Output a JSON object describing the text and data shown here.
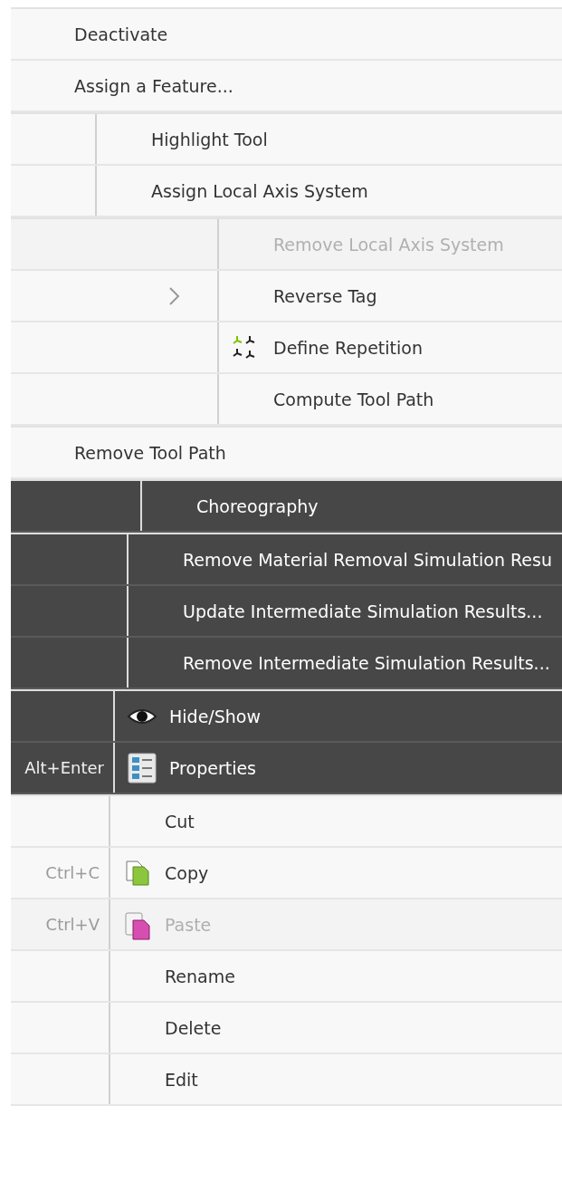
{
  "menus": [
    {
      "kind": "light",
      "items": [
        {
          "label": "Deactivate",
          "disabled": false,
          "submenu": false,
          "kind": "plain"
        },
        {
          "label": "Assign a Feature...",
          "disabled": false,
          "submenu": false,
          "kind": "plain"
        }
      ]
    },
    {
      "kind": "light",
      "items": [
        {
          "label": "Highlight Tool",
          "disabled": false,
          "submenu": false,
          "kind": "plain"
        },
        {
          "label": "Assign Local Axis System",
          "disabled": false,
          "submenu": false,
          "kind": "plain"
        }
      ]
    },
    {
      "kind": "light",
      "items": [
        {
          "label": "Remove Local Axis System",
          "disabled": true,
          "submenu": false,
          "kind": "plain"
        },
        {
          "label": "Reverse Tag",
          "disabled": false,
          "submenu": true,
          "kind": "plain"
        },
        {
          "label": "Define Repetition",
          "disabled": false,
          "submenu": false,
          "kind": "repeat"
        },
        {
          "label": "Compute Tool Path",
          "disabled": false,
          "submenu": false,
          "kind": "plain"
        }
      ]
    },
    {
      "kind": "light",
      "items": [
        {
          "label": "Remove Tool Path",
          "disabled": false,
          "submenu": false,
          "kind": "plain"
        }
      ]
    },
    {
      "kind": "dark",
      "items": [
        {
          "label": "Choreography",
          "disabled": false,
          "submenu": false,
          "kind": "plain"
        }
      ]
    },
    {
      "kind": "dark",
      "items": [
        {
          "label": "Remove Material Removal Simulation Resu",
          "disabled": false,
          "submenu": false,
          "kind": "plain"
        },
        {
          "label": "Update Intermediate Simulation Results...",
          "disabled": false,
          "submenu": false,
          "kind": "plain"
        },
        {
          "label": "Remove Intermediate Simulation Results...",
          "disabled": false,
          "submenu": false,
          "kind": "plain"
        }
      ]
    },
    {
      "kind": "dark",
      "items": [
        {
          "label": "Hide/Show",
          "disabled": false,
          "submenu": false,
          "kind": "eye"
        },
        {
          "label": "Properties",
          "shortcut": "Alt+Enter",
          "disabled": false,
          "submenu": false,
          "kind": "props"
        }
      ]
    },
    {
      "kind": "light",
      "items": [
        {
          "label": "Cut",
          "disabled": false,
          "submenu": false,
          "kind": "plain"
        },
        {
          "label": "Copy",
          "shortcut": "Ctrl+C",
          "disabled": false,
          "submenu": false,
          "kind": "copy"
        },
        {
          "label": "Paste",
          "shortcut": "Ctrl+V",
          "disabled": true,
          "submenu": false,
          "kind": "paste"
        },
        {
          "label": "Rename",
          "disabled": false,
          "submenu": false,
          "kind": "plain"
        },
        {
          "label": "Delete",
          "disabled": false,
          "submenu": false,
          "kind": "plain"
        },
        {
          "label": "Edit",
          "disabled": false,
          "submenu": false,
          "kind": "plain"
        }
      ]
    }
  ]
}
